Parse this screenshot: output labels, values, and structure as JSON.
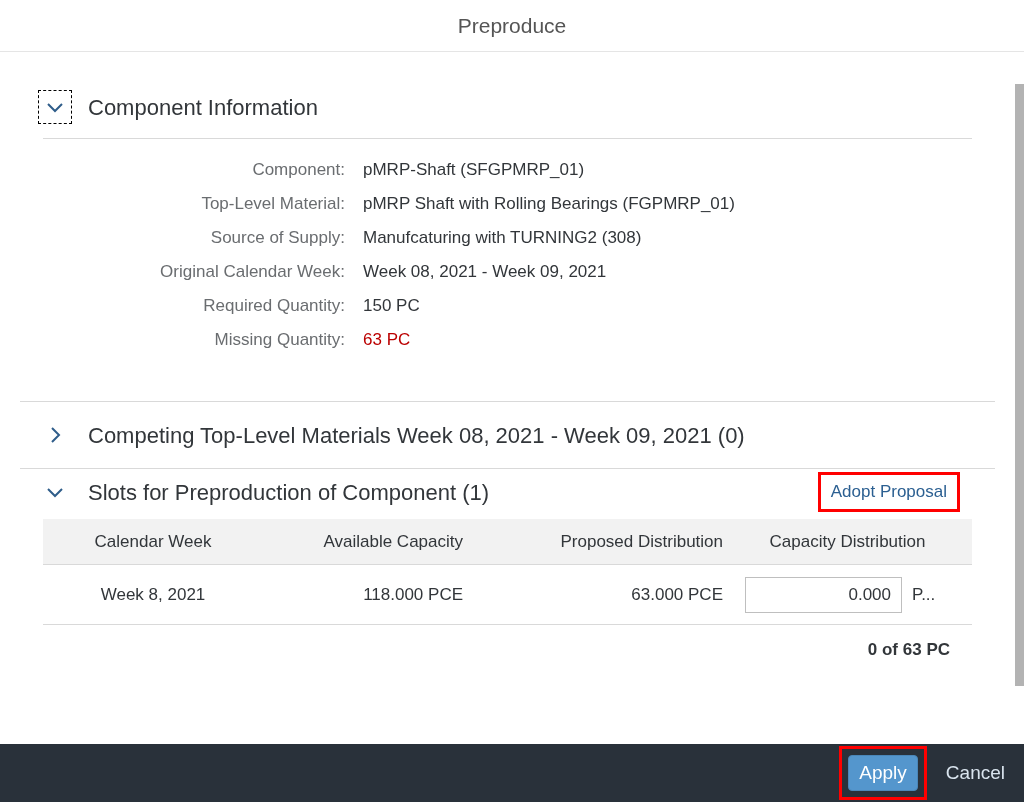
{
  "dialog": {
    "title": "Preproduce"
  },
  "sections": [
    {
      "title": "Component Information",
      "expanded": true,
      "focused": true,
      "kind": "details",
      "fields": [
        {
          "label": "Component:",
          "value": "pMRP-Shaft (SFGPMRP_01)",
          "alert": false
        },
        {
          "label": "Top-Level Material:",
          "value": "pMRP Shaft with Rolling Bearings (FGPMRP_01)",
          "alert": false
        },
        {
          "label": "Source of Supply:",
          "value": "Manufcaturing with TURNING2 (308)",
          "alert": false
        },
        {
          "label": "Original Calendar Week:",
          "value": "Week 08, 2021 - Week 09, 2021",
          "alert": false
        },
        {
          "label": "Required Quantity:",
          "value": "150 PC",
          "alert": false
        },
        {
          "label": "Missing Quantity:",
          "value": "63 PC",
          "alert": true
        }
      ]
    },
    {
      "title": "Competing Top-Level Materials Week 08, 2021 - Week 09, 2021 (0)",
      "expanded": false,
      "focused": false,
      "kind": "list"
    },
    {
      "title": "Slots for Preproduction of Component (1)",
      "expanded": true,
      "focused": false,
      "kind": "table",
      "action": {
        "label": "Adopt Proposal",
        "highlighted": true
      },
      "table": {
        "columns": [
          "Calendar Week",
          "Available Capacity",
          "Proposed Distribution",
          "Capacity Distribution"
        ],
        "rows": [
          {
            "week": "Week 8, 2021",
            "available": "118.000 PCE",
            "proposed": "63.000 PCE",
            "distribution": "0.000",
            "unit": "P..."
          }
        ],
        "total": "0 of 63 PC"
      }
    }
  ],
  "footer": {
    "buttons": [
      {
        "label": "Apply",
        "kind": "primary",
        "highlighted": true
      },
      {
        "label": "Cancel",
        "kind": "secondary",
        "highlighted": false
      }
    ]
  }
}
